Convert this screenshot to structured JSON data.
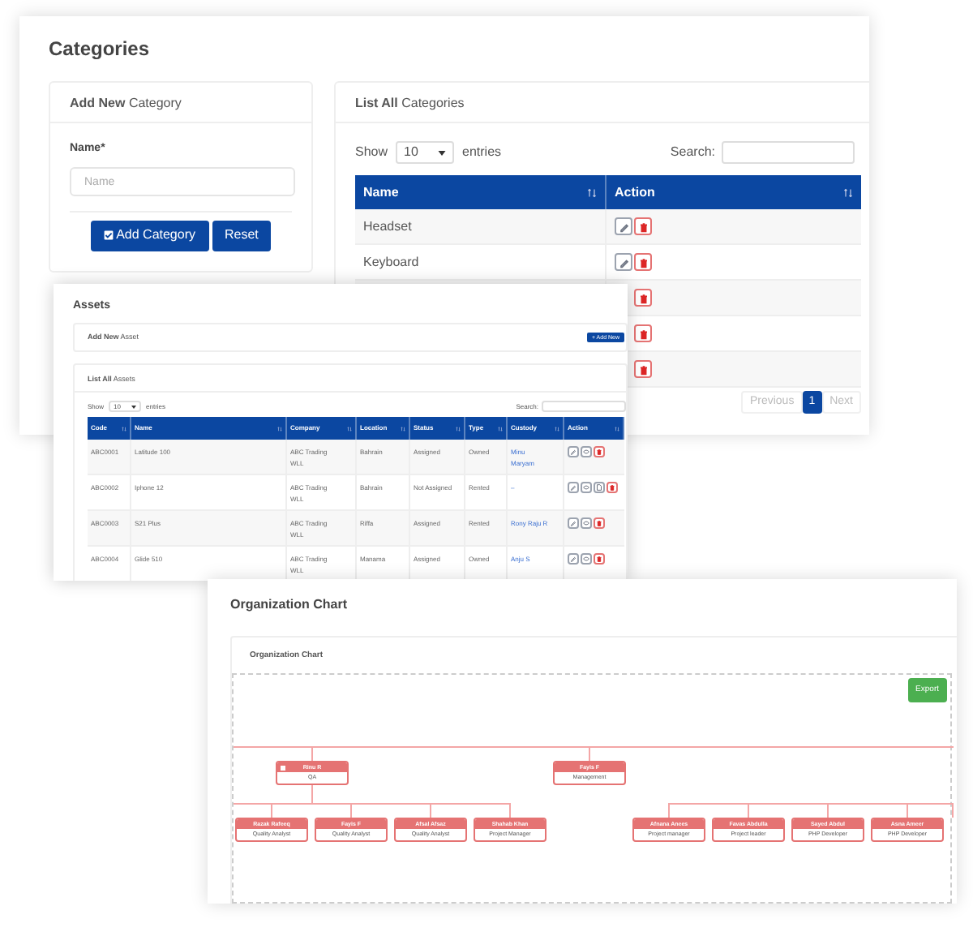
{
  "categories": {
    "title": "Categories",
    "add_card": {
      "title_bold": "Add New",
      "title_rest": "Category",
      "field_label": "Name*",
      "placeholder": "Name",
      "buttons": [
        {
          "label": "Add Category",
          "kind": "check"
        },
        {
          "label": "Reset",
          "kind": "plain"
        }
      ]
    },
    "list_card": {
      "title_bold": "List All",
      "title_rest": "Categories",
      "show_label": "Show",
      "page_size": "10",
      "entries_label": "entries",
      "search_label": "Search:",
      "columns": [
        "Name",
        "Action"
      ],
      "rows": [
        {
          "name": "Headset",
          "actions": [
            {
              "kind": "edit"
            },
            {
              "kind": "delete"
            }
          ]
        },
        {
          "name": "Keyboard",
          "actions": [
            {
              "kind": "edit"
            },
            {
              "kind": "delete"
            }
          ]
        },
        {
          "actions": [
            {
              "kind": "delete"
            }
          ]
        },
        {
          "actions": [
            {
              "kind": "delete"
            }
          ]
        },
        {
          "actions": [
            {
              "kind": "delete"
            }
          ]
        }
      ],
      "pagination": [
        {
          "label": "Previous",
          "selected": false
        },
        {
          "label": "1",
          "selected": true
        },
        {
          "label": "Next",
          "selected": false
        }
      ]
    }
  },
  "assets": {
    "title": "Assets",
    "add_card": {
      "title_bold": "Add New",
      "title_rest": "Asset",
      "button": "+ Add New"
    },
    "list_card": {
      "title_bold": "List All",
      "title_rest": "Assets",
      "show_label": "Show",
      "page_size": "10",
      "entries_label": "entries",
      "search_label": "Search:",
      "columns": [
        "Code",
        "Name",
        "Company",
        "Location",
        "Status",
        "Type",
        "Custody",
        "Action"
      ],
      "rows": [
        {
          "cells": [
            "ABC0001",
            "Latitude 100",
            "ABC Trading WLL",
            "Bahrain",
            "Assigned",
            "Owned"
          ],
          "custody": "Minu Maryam",
          "actions": [
            {
              "kind": "edit"
            },
            {
              "kind": "view"
            },
            {
              "kind": "delete"
            }
          ]
        },
        {
          "cells": [
            "ABC0002",
            "Iphone 12",
            "ABC Trading WLL",
            "Bahrain",
            "Not Assigned",
            "Rented"
          ],
          "custody": "–",
          "actions": [
            {
              "kind": "edit"
            },
            {
              "kind": "view"
            },
            {
              "kind": "document"
            },
            {
              "kind": "delete"
            }
          ]
        },
        {
          "cells": [
            "ABC0003",
            "S21 Plus",
            "ABC Trading WLL",
            "Riffa",
            "Assigned",
            "Rented"
          ],
          "custody": "Rony Raju R",
          "actions": [
            {
              "kind": "edit"
            },
            {
              "kind": "view"
            },
            {
              "kind": "delete"
            }
          ]
        },
        {
          "cells": [
            "ABC0004",
            "Glide 510",
            "ABC Trading WLL",
            "Manama",
            "Assigned",
            "Owned"
          ],
          "custody": "Anju S",
          "actions": [
            {
              "kind": "edit"
            },
            {
              "kind": "view"
            },
            {
              "kind": "delete"
            }
          ]
        }
      ]
    }
  },
  "org_chart": {
    "title": "Organization Chart",
    "card_title": "Organization Chart",
    "export_button": "Export",
    "nodes": [
      {
        "name": "Rinu R",
        "role": "QA",
        "children": [
          {
            "name": "Razak Rafeeq",
            "role": "Quality Analyst"
          },
          {
            "name": "Fayis F",
            "role": "Quality Analyst"
          },
          {
            "name": "Afsal Afsaz",
            "role": "Quality Analyst"
          },
          {
            "name": "Shahab Khan",
            "role": "Project Manager"
          }
        ]
      },
      {
        "name": "Fayis F",
        "role": "Management"
      }
    ],
    "lower_row_nodes": [
      {
        "name": "Afnana Anees",
        "role": "Project manager"
      },
      {
        "name": "Favas Abdulla",
        "role": "Project leader"
      },
      {
        "name": "Sayed Abdul",
        "role": "PHP Developer"
      },
      {
        "name": "Asna Ameer",
        "role": "PHP Developer"
      }
    ]
  }
}
